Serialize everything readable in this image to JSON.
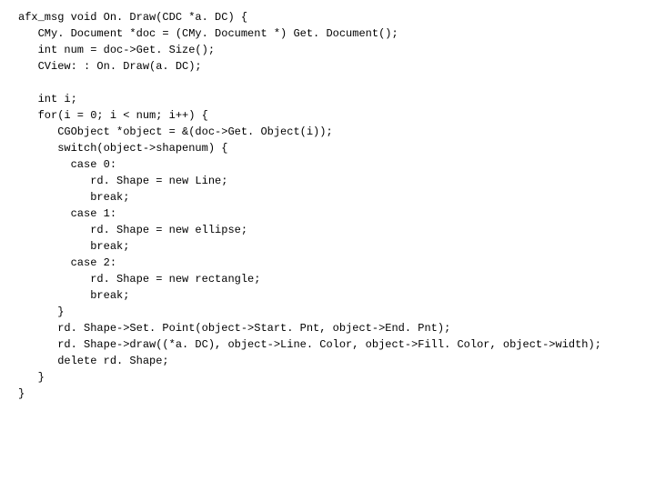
{
  "code": {
    "lines": [
      "afx_msg void On. Draw(CDC *a. DC) {",
      "   CMy. Document *doc = (CMy. Document *) Get. Document();",
      "   int num = doc->Get. Size();",
      "   CView: : On. Draw(a. DC);",
      "",
      "   int i;",
      "   for(i = 0; i < num; i++) {",
      "      CGObject *object = &(doc->Get. Object(i));",
      "      switch(object->shapenum) {",
      "        case 0:",
      "           rd. Shape = new Line;",
      "           break;",
      "        case 1:",
      "           rd. Shape = new ellipse;",
      "           break;",
      "        case 2:",
      "           rd. Shape = new rectangle;",
      "           break;",
      "      }",
      "      rd. Shape->Set. Point(object->Start. Pnt, object->End. Pnt);",
      "      rd. Shape->draw((*a. DC), object->Line. Color, object->Fill. Color, object->width);",
      "      delete rd. Shape;",
      "   }",
      "}"
    ]
  }
}
